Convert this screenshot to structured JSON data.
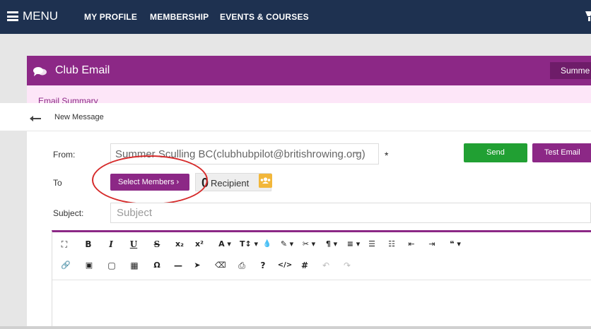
{
  "nav": {
    "menu_label": "MENU",
    "links": [
      "MY PROFILE",
      "MEMBERSHIP",
      "EVENTS & COURSES"
    ]
  },
  "panel": {
    "title": "Club Email",
    "right_button_label": "Summe",
    "tab_label": "Email Summary",
    "accent_color": "#8c2886"
  },
  "subbar": {
    "title": "New Message"
  },
  "form": {
    "from_label": "From:",
    "from_value": "Summer Sculling BC(clubhubpilot@britishrowing.org)",
    "required_marker": "*",
    "to_label": "To",
    "subject_label": "Subject:",
    "subject_placeholder": "Subject",
    "send_label": "Send",
    "test_email_label": "Test Email",
    "select_members_label": "Select Members ›",
    "recipient_count": "0",
    "recipient_label": "Recipient"
  },
  "toolbar": {
    "row1": [
      "⛶",
      "B",
      "I",
      "U",
      "S",
      "x₂",
      "x²",
      "A ▾",
      "T↕ ▾",
      "💧",
      "✎ ▾",
      "✂ ▾",
      "¶ ▾",
      "≡ ▾",
      "☰",
      "☷",
      "⇤",
      "⇥",
      "❝ ▾"
    ],
    "row2": [
      "🔗",
      "▣",
      "▢",
      "▦",
      "Ω",
      "—",
      "➤",
      "⌫",
      "⎙",
      "?",
      "</>",
      "#",
      "↶",
      "↷"
    ]
  }
}
